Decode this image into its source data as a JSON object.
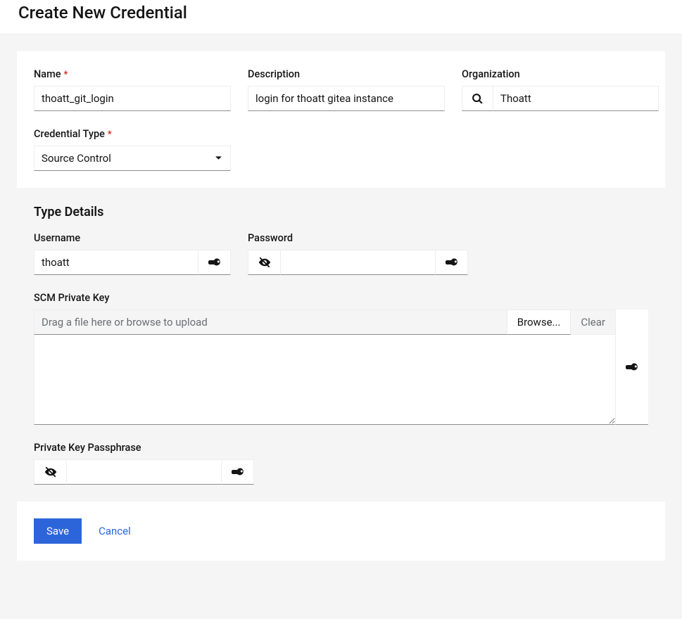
{
  "page_title": "Create New Credential",
  "top": {
    "name": {
      "label": "Name",
      "value": "thoatt_git_login"
    },
    "description": {
      "label": "Description",
      "value": "login for thoatt gitea instance"
    },
    "organization": {
      "label": "Organization",
      "value": "Thoatt"
    },
    "credential_type": {
      "label": "Credential Type",
      "value": "Source Control"
    }
  },
  "details": {
    "heading": "Type Details",
    "username": {
      "label": "Username",
      "value": "thoatt"
    },
    "password": {
      "label": "Password",
      "value": ""
    },
    "scm_key": {
      "label": "SCM Private Key",
      "placeholder": "Drag a file here or browse to upload",
      "browse": "Browse...",
      "clear": "Clear",
      "value": ""
    },
    "passphrase": {
      "label": "Private Key Passphrase",
      "value": ""
    }
  },
  "actions": {
    "save": "Save",
    "cancel": "Cancel"
  }
}
